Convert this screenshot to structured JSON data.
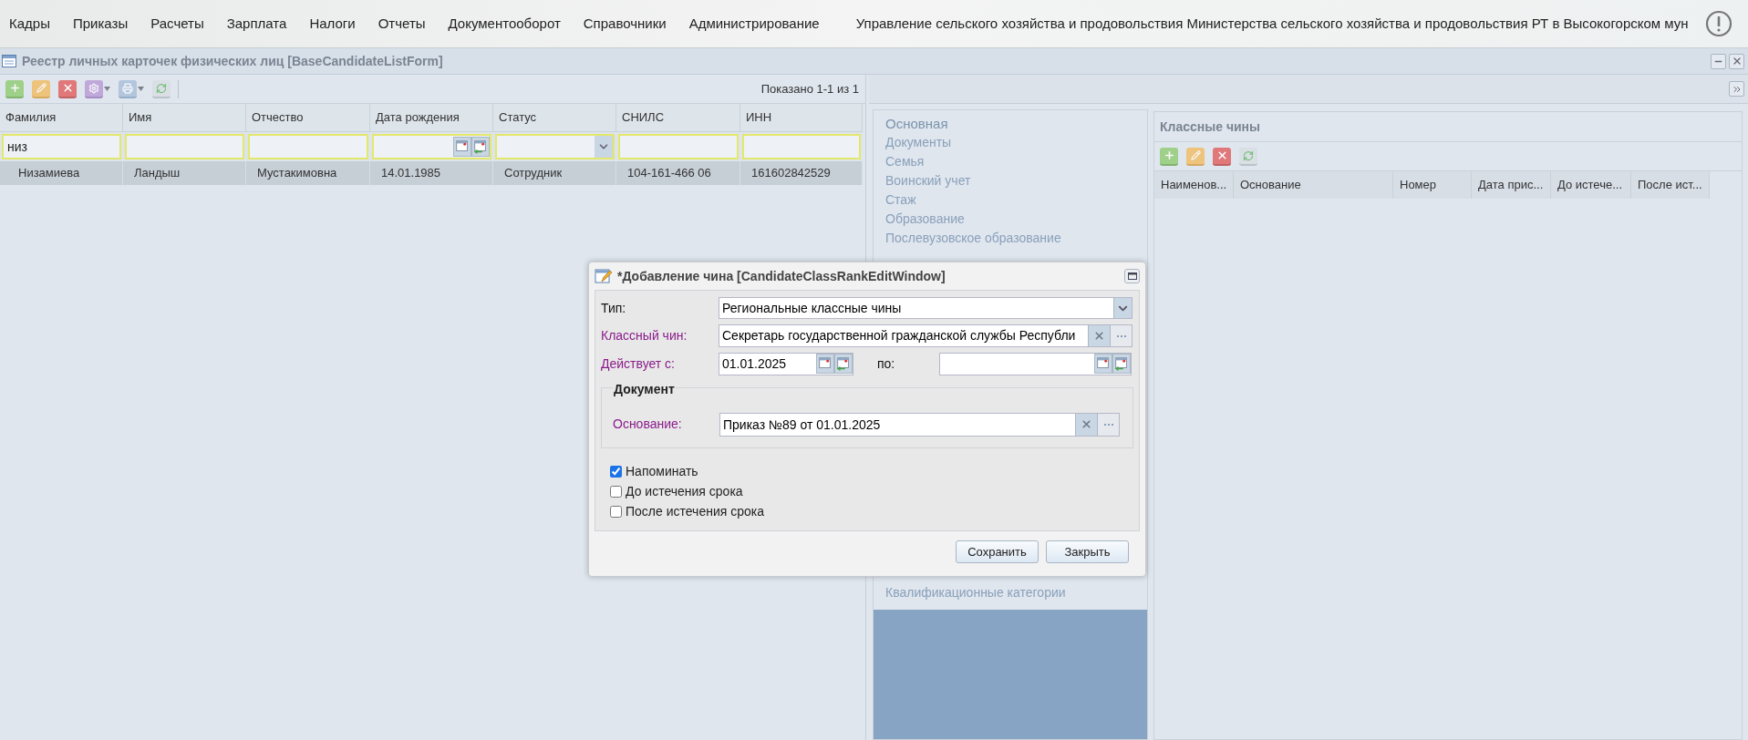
{
  "menu": {
    "items": [
      {
        "label": "Кадры"
      },
      {
        "label": "Приказы"
      },
      {
        "label": "Расчеты"
      },
      {
        "label": "Зарплата"
      },
      {
        "label": "Налоги"
      },
      {
        "label": "Отчеты"
      },
      {
        "label": "Документооборот"
      },
      {
        "label": "Справочники"
      },
      {
        "label": "Администрирование"
      }
    ],
    "organization": "Управление сельского хозяйства и продовольствия Министерства сельского хозяйства и продовольствия РТ в Высокогорском мун"
  },
  "list_window": {
    "title": "Реестр личных карточек физических лиц [BaseCandidateListForm]",
    "counter": "Показано 1-1 из 1",
    "columns": [
      {
        "label": "Фамилия",
        "kind": "text",
        "filter": "низ"
      },
      {
        "label": "Имя",
        "kind": "text"
      },
      {
        "label": "Отчество",
        "kind": "text"
      },
      {
        "label": "Дата рождения",
        "kind": "date"
      },
      {
        "label": "Статус",
        "kind": "combo"
      },
      {
        "label": "СНИЛС",
        "kind": "text"
      },
      {
        "label": "ИНН",
        "kind": "text"
      }
    ],
    "rows": [
      {
        "cells": [
          "Низамиева",
          "Ландыш",
          "Мустакимовна",
          "14.01.1985",
          "Сотрудник",
          "104-161-466 06",
          "161602842529"
        ],
        "selected": true
      }
    ]
  },
  "card": {
    "sections_top": [
      {
        "label": "Основная",
        "selected": true
      },
      {
        "label": "Документы",
        "selected": false
      },
      {
        "label": "Семья",
        "selected": false
      },
      {
        "label": "Воинский учет",
        "selected": false
      },
      {
        "label": "Стаж",
        "selected": false
      },
      {
        "label": "Образование",
        "selected": false
      },
      {
        "label": "Послевузовское образование",
        "selected": false
      }
    ],
    "sections_bottom": [
      {
        "label": "Квалификационные категории",
        "selected": false
      }
    ],
    "class_ranks": {
      "title": "Классные чины",
      "columns": [
        "Наименов...",
        "Основание",
        "Номер",
        "Дата прис...",
        "До истече...",
        "После ист..."
      ]
    }
  },
  "dialog": {
    "title": "*Добавление чина [CandidateClassRankEditWindow]",
    "fields": [
      {
        "kind": "combo",
        "label": "Тип:",
        "required": false,
        "value": "Региональные классные чины"
      },
      {
        "kind": "lookup",
        "label": "Классный чин:",
        "required": true,
        "value": "Секретарь государственной гражданской службы Республи"
      },
      {
        "kind": "daterange",
        "label": "Действует с:",
        "required": true,
        "value": "01.01.2025",
        "to_label": "по:"
      }
    ],
    "document": {
      "legend": "Документ",
      "fields": [
        {
          "kind": "lookup",
          "label": "Основание:",
          "required": true,
          "value": "Приказ №89 от 01.01.2025"
        }
      ]
    },
    "checkboxes": [
      {
        "label": "Напоминать",
        "checked": true
      },
      {
        "label": "До истечения срока",
        "checked": false
      },
      {
        "label": "После истечения срока",
        "checked": false
      }
    ],
    "buttons": [
      "Сохранить",
      "Закрыть"
    ]
  }
}
